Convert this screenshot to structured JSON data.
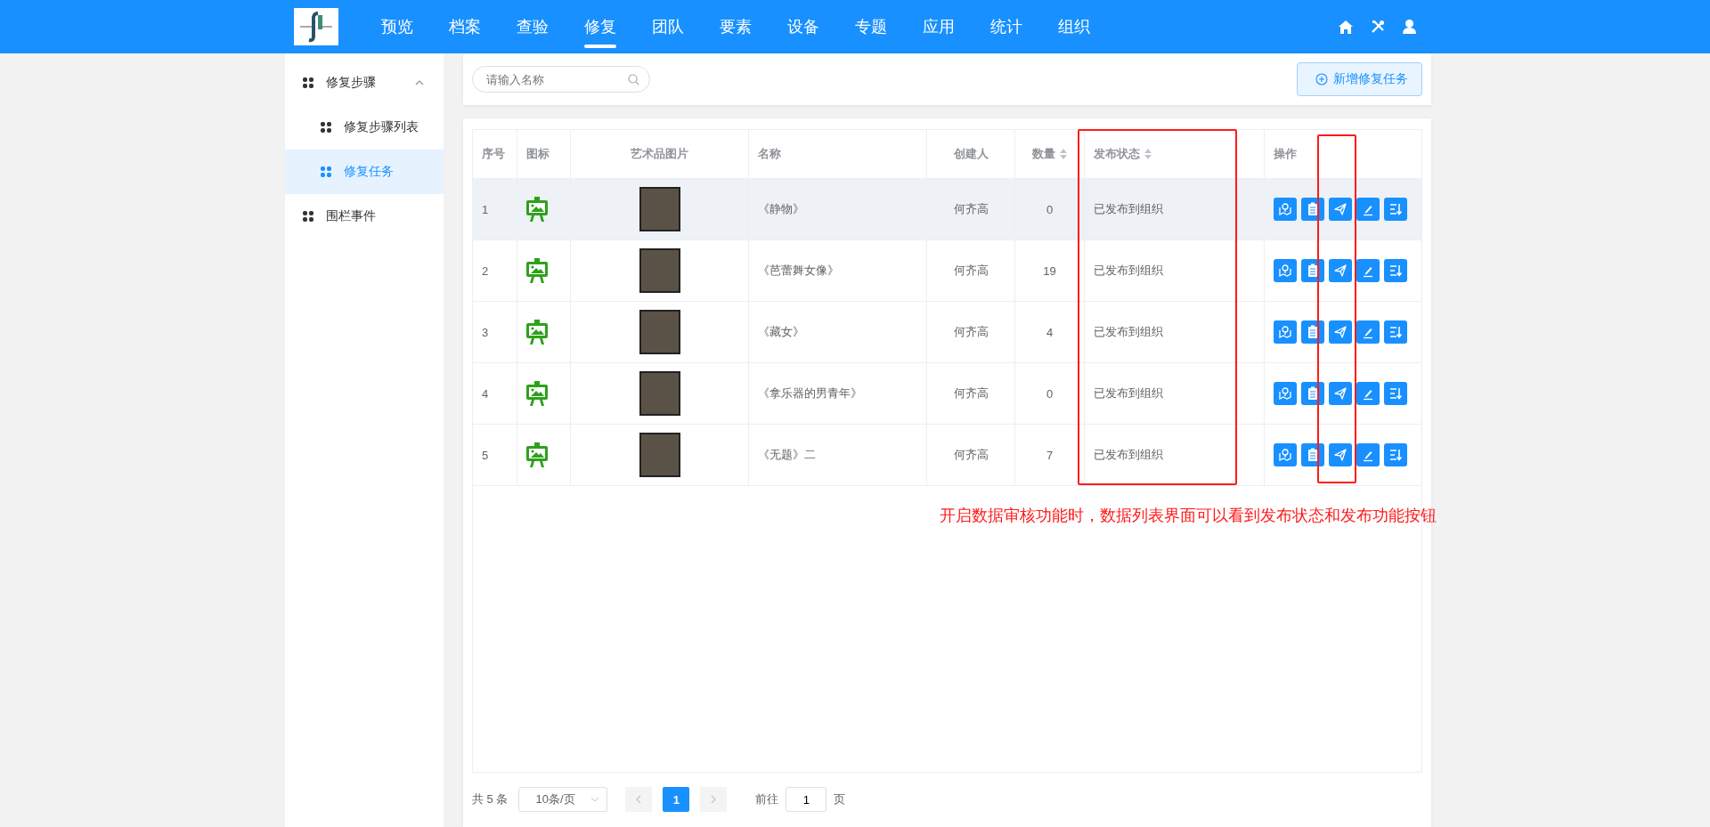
{
  "nav": {
    "items": [
      {
        "label": "预览",
        "selected": false
      },
      {
        "label": "档案",
        "selected": false
      },
      {
        "label": "查验",
        "selected": false
      },
      {
        "label": "修复",
        "selected": true
      },
      {
        "label": "团队",
        "selected": false
      },
      {
        "label": "要素",
        "selected": false
      },
      {
        "label": "设备",
        "selected": false
      },
      {
        "label": "专题",
        "selected": false
      },
      {
        "label": "应用",
        "selected": false
      },
      {
        "label": "统计",
        "selected": false
      },
      {
        "label": "组织",
        "selected": false
      }
    ]
  },
  "sidebar": {
    "items": [
      {
        "label": "修复步骤",
        "expanded": true,
        "selected": false,
        "children": [
          {
            "label": "修复步骤列表",
            "selected": false
          },
          {
            "label": "修复任务",
            "selected": true
          }
        ]
      },
      {
        "label": "围栏事件",
        "selected": false
      }
    ]
  },
  "search": {
    "placeholder": "请输入名称"
  },
  "add_button": "新增修复任务",
  "table": {
    "columns": [
      {
        "label": "序号",
        "sortable": false
      },
      {
        "label": "图标",
        "sortable": false
      },
      {
        "label": "艺术品图片",
        "sortable": false
      },
      {
        "label": "名称",
        "sortable": false
      },
      {
        "label": "创建人",
        "sortable": false
      },
      {
        "label": "数量",
        "sortable": true
      },
      {
        "label": "发布状态",
        "sortable": true
      },
      {
        "label": "操作",
        "sortable": false
      }
    ],
    "rows": [
      {
        "index": "1",
        "name": "《静物》",
        "creator": "何齐高",
        "count": "0",
        "status": "已发布到组织",
        "highlighted": true
      },
      {
        "index": "2",
        "name": "《芭蕾舞女像》",
        "creator": "何齐高",
        "count": "19",
        "status": "已发布到组织",
        "highlighted": false
      },
      {
        "index": "3",
        "name": "《藏女》",
        "creator": "何齐高",
        "count": "4",
        "status": "已发布到组织",
        "highlighted": false
      },
      {
        "index": "4",
        "name": "《拿乐器的男青年》",
        "creator": "何齐高",
        "count": "0",
        "status": "已发布到组织",
        "highlighted": false
      },
      {
        "index": "5",
        "name": "《无题》二",
        "creator": "何齐高",
        "count": "7",
        "status": "已发布到组织",
        "highlighted": false
      }
    ]
  },
  "pagination": {
    "total": "共 5 条",
    "page_size": "10条/页",
    "pages": [
      {
        "label": "1",
        "selected": true
      }
    ],
    "goto_label": "前往",
    "goto_value": "1",
    "page_unit": "页"
  },
  "annotation": {
    "text": "开启数据审核功能时，数据列表界面可以看到发布状态和发布功能按钮"
  }
}
